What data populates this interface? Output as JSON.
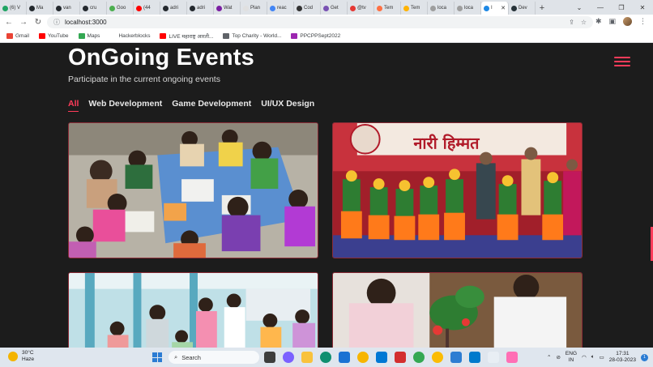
{
  "browser": {
    "tabs": [
      {
        "title": "(6) V",
        "color": "#1fa463"
      },
      {
        "title": "Ma",
        "color": "#24292e"
      },
      {
        "title": "van",
        "color": "#24292e"
      },
      {
        "title": "cru",
        "color": "#24292e"
      },
      {
        "title": "Goo",
        "color": "#4caf50"
      },
      {
        "title": "(44",
        "color": "#ff0000"
      },
      {
        "title": "adri",
        "color": "#24292e"
      },
      {
        "title": "adri",
        "color": "#24292e"
      },
      {
        "title": "Wat",
        "color": "#7b1fa2"
      },
      {
        "title": "Plan",
        "color": "#e0e0e0"
      },
      {
        "title": "reac",
        "color": "#4285f4"
      },
      {
        "title": "Cod",
        "color": "#333333"
      },
      {
        "title": "Get",
        "color": "#7952b3"
      },
      {
        "title": "@tv",
        "color": "#e53935"
      },
      {
        "title": "Tem",
        "color": "#ff7043"
      },
      {
        "title": "Tem",
        "color": "#ffb300"
      },
      {
        "title": "loca",
        "color": "#9e9e9e"
      },
      {
        "title": "loca",
        "color": "#9e9e9e"
      },
      {
        "title": "I",
        "color": "#1e88e5"
      },
      {
        "title": "Dev",
        "color": "#263238"
      }
    ],
    "active_tab_index": 18,
    "new_tab_label": "+",
    "url": "localhost:3000",
    "bookmarks": [
      {
        "label": "Gmail",
        "color": "#ea4335"
      },
      {
        "label": "YouTube",
        "color": "#ff0000"
      },
      {
        "label": "Maps",
        "color": "#34a853"
      },
      {
        "label": "Hackerblocks",
        "color": "#ffffff"
      },
      {
        "label": "LIVE महाराष्ट्र आरती...",
        "color": "#ff0000"
      },
      {
        "label": "Top Charity - World...",
        "color": "#5f6368"
      },
      {
        "label": "PPCPPSept2022",
        "color": "#9c27b0"
      }
    ]
  },
  "page": {
    "title": "OnGoing Events",
    "subtitle": "Participate in the current ongoing events",
    "filters": [
      "All",
      "Web Development",
      "Game Development",
      "UI/UX Design"
    ],
    "active_filter": "All",
    "banner_text": "नारी हिम्मत",
    "accent": "#ff3c5a"
  },
  "taskbar": {
    "temperature": "30°C",
    "weather": "Haze",
    "search_label": "Search",
    "lang_line1": "ENG",
    "lang_line2": "IN",
    "time": "17:31",
    "date": "28-03-2023",
    "notification_count": "1"
  }
}
